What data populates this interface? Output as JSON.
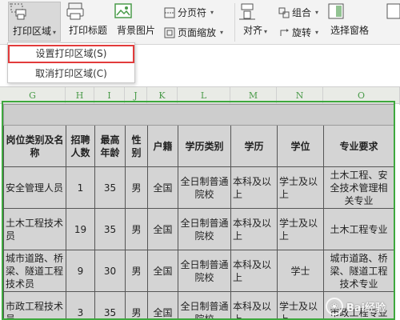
{
  "ribbon": {
    "print_area_label": "打印区域",
    "print_titles_label": "打印标题",
    "background_label": "背景图片",
    "page_break_label": "分页符",
    "page_zoom_label": "页面缩放",
    "group_label": "组合",
    "rotate_label": "旋转",
    "align_label": "对齐",
    "selection_pane_label": "选择窗格"
  },
  "menu": {
    "set_print_area": "设置打印区域(S)",
    "cancel_print_area": "取消打印区域(C)"
  },
  "sheet": {
    "column_letters": [
      "G",
      "H",
      "I",
      "J",
      "K",
      "L",
      "M",
      "N",
      "O"
    ],
    "headers": [
      "岗位类别及名称",
      "招聘人数",
      "最高年龄",
      "性别",
      "户籍",
      "学历类别",
      "学历",
      "学位",
      "专业要求"
    ],
    "rows": [
      [
        "安全管理人员",
        "1",
        "35",
        "男",
        "全国",
        "全日制普通院校",
        "本科及以上",
        "学士及以上",
        "土木工程、安全技术管理相关专业"
      ],
      [
        "土木工程技术员",
        "19",
        "35",
        "男",
        "全国",
        "全日制普通院校",
        "本科及以上",
        "学士及以上",
        "土木工程专业"
      ],
      [
        "城市道路、桥梁、隧道工程技术员",
        "9",
        "30",
        "男",
        "全国",
        "全日制普通院校",
        "本科及以上",
        "学士",
        "城市道路、桥梁、隧道工程技术专业"
      ],
      [
        "市政工程技术员",
        "3",
        "35",
        "男",
        "全国",
        "全日制普通院校",
        "本科及以上",
        "学士及以上",
        "市政工程专业"
      ]
    ]
  },
  "watermark": "Bai经验"
}
